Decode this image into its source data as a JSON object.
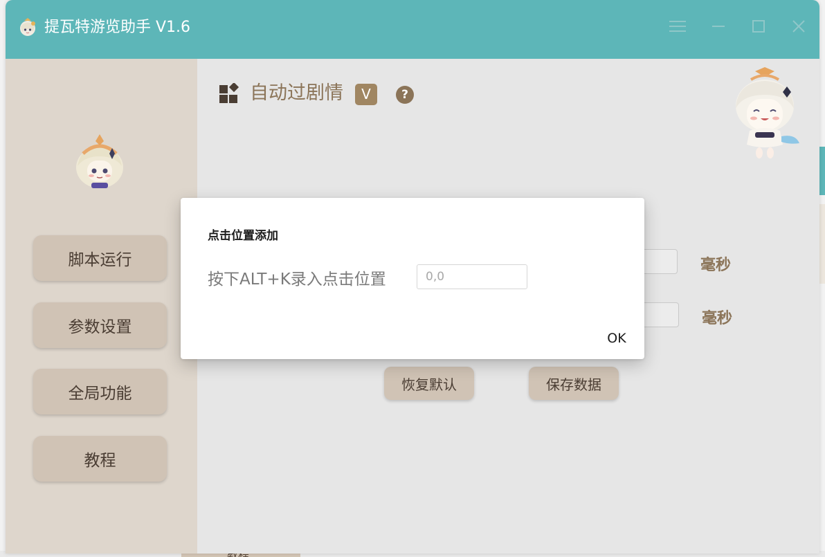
{
  "window": {
    "title": "提瓦特游览助手 V1.6",
    "app_icon": "paimon-icon",
    "controls": [
      "menu-icon",
      "minimize-icon",
      "maximize-icon",
      "close-icon"
    ]
  },
  "sidebar": {
    "avatar": "paimon-avatar",
    "items": [
      {
        "label": "脚本运行"
      },
      {
        "label": "参数设置"
      },
      {
        "label": "全局功能"
      },
      {
        "label": "教程"
      }
    ]
  },
  "main": {
    "feature_icon": "grid-widget-icon",
    "feature_title": "自动过剧情",
    "hotkey_badge": "V",
    "help_symbol": "?",
    "mascot": "paimon-mascot",
    "unit_labels": [
      "毫秒",
      "毫秒"
    ],
    "buttons": {
      "reset": "恢复默认",
      "save": "保存数据"
    }
  },
  "dialog": {
    "title": "点击位置添加",
    "label": "按下ALT+K录入点击位置",
    "input_placeholder": "0,0",
    "ok": "OK"
  },
  "background": {
    "peek_tab_label": "教程"
  },
  "colors": {
    "titlebar": "#5db6b8",
    "sidebar": "#ded6cc",
    "nav_button": "#d0c3b5",
    "accent_brown": "#8b7458",
    "badge": "#a08662"
  }
}
